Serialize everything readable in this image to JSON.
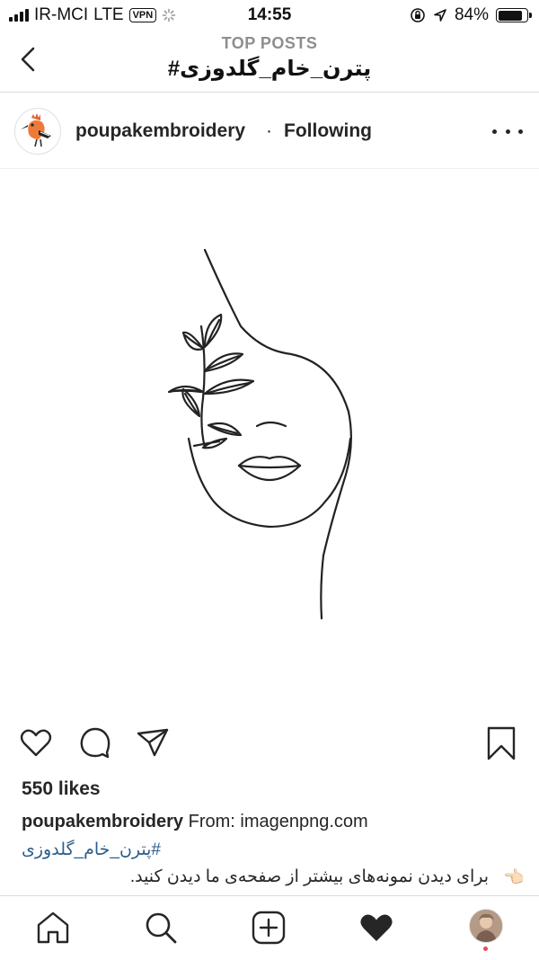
{
  "status_bar": {
    "carrier": "IR-MCI",
    "network": "LTE",
    "vpn": "VPN",
    "time": "14:55",
    "battery_percent": "84%",
    "battery_level": 0.84
  },
  "header": {
    "subtitle": "TOP POSTS",
    "title": "#پترن_خام_گلدوزی"
  },
  "post": {
    "username": "poupakembroidery",
    "separator": "·",
    "follow_status": "Following",
    "likes": "550 likes",
    "caption_user": "poupakembroidery",
    "caption_text": "From: imagenpng.com",
    "hashtag": "#پترن_خام_گلدوزی",
    "description": "برای دیدن نمونه‌های بیشتر از صفحه‌ی ما دیدن کنید.",
    "description_emoji": "👈🏻"
  },
  "icons": {
    "back": "chevron-left-icon",
    "more": "more-horizontal-icon",
    "like": "heart-icon",
    "comment": "comment-icon",
    "share": "send-icon",
    "save": "bookmark-icon",
    "home": "home-icon",
    "search": "search-icon",
    "add": "add-post-icon",
    "activity": "heart-filled-icon",
    "profile": "profile-avatar"
  },
  "colors": {
    "hashtag": "#2c5e8a",
    "notification_dot": "#ed4956"
  }
}
